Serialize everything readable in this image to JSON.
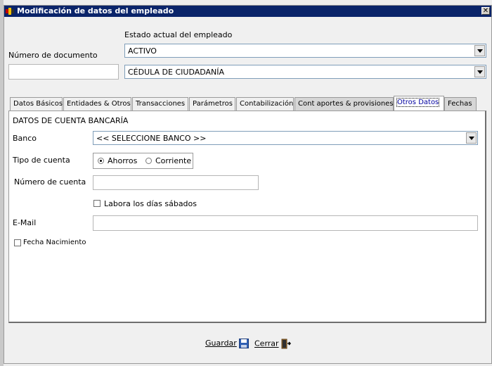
{
  "window": {
    "title": "Modificación de datos del empleado"
  },
  "header": {
    "estado_label": "Estado actual del empleado",
    "estado_value": "ACTIVO",
    "documento_label": "Número de documento",
    "documento_value": "",
    "tipo_documento_value": "CÉDULA DE CIUDADANÍA"
  },
  "tabs": [
    {
      "label": "Datos Básicos"
    },
    {
      "label": "Entidades & Otros"
    },
    {
      "label": "Transacciones"
    },
    {
      "label": "Parámetros"
    },
    {
      "label": "Contabilización"
    },
    {
      "label": "Cont aportes & provisiones"
    },
    {
      "label": "Otros Datos",
      "active": true
    },
    {
      "label": "Fechas"
    }
  ],
  "otros_datos": {
    "section_title": "DATOS DE CUENTA BANCARÍA",
    "banco_label": "Banco",
    "banco_value": "<< SELECCIONE BANCO >>",
    "tipo_cuenta_label": "Tipo de cuenta",
    "tipo_cuenta_options": [
      "Ahorros",
      "Corriente"
    ],
    "tipo_cuenta_selected": "Ahorros",
    "numero_cuenta_label": "Número de cuenta",
    "numero_cuenta_value": "",
    "labora_sabados_label": "Labora los días sábados",
    "labora_sabados_checked": false,
    "email_label": "E-Mail",
    "email_value": "",
    "fecha_nacimiento_label": "Fecha Nacimiento",
    "fecha_nacimiento_checked": false
  },
  "footer": {
    "guardar_label": "Guardar",
    "cerrar_label": "Cerrar"
  },
  "colors": {
    "titlebar": "#0a246a",
    "active_tab_text": "#0000a0"
  }
}
